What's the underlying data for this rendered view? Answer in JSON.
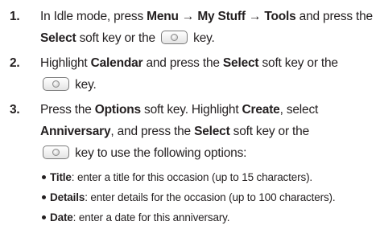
{
  "steps": [
    {
      "number": "1.",
      "t1": "In Idle mode, press ",
      "menu": "Menu",
      "arrow1": " → ",
      "my_stuff": "My Stuff",
      "arrow2": " → ",
      "tools": "Tools",
      "t2": " and press the ",
      "select": "Select",
      "t3": " soft key or the ",
      "t4": " key."
    },
    {
      "number": "2.",
      "t1": "Highlight ",
      "calendar": "Calendar",
      "t2": " and press the ",
      "select": "Select",
      "t3": " soft key or the ",
      "t4": " key."
    },
    {
      "number": "3.",
      "t1": "Press the ",
      "options": "Options",
      "t2": " soft key. Highlight ",
      "create": "Create",
      "t3": ", select ",
      "anniversary": "Anniversary",
      "t4": ", and press the ",
      "select": "Select",
      "t5": " soft key or the ",
      "t6": " key to use the following options:"
    }
  ],
  "options": [
    {
      "label": "Title",
      "text": ": enter a title for this occasion (up to 15 characters)."
    },
    {
      "label": "Details",
      "text": ": enter details for the occasion (up to 100 characters)."
    },
    {
      "label": "Date",
      "text": ": enter a date for this anniversary."
    }
  ],
  "icons": {
    "key": "ok-center-key-icon"
  }
}
